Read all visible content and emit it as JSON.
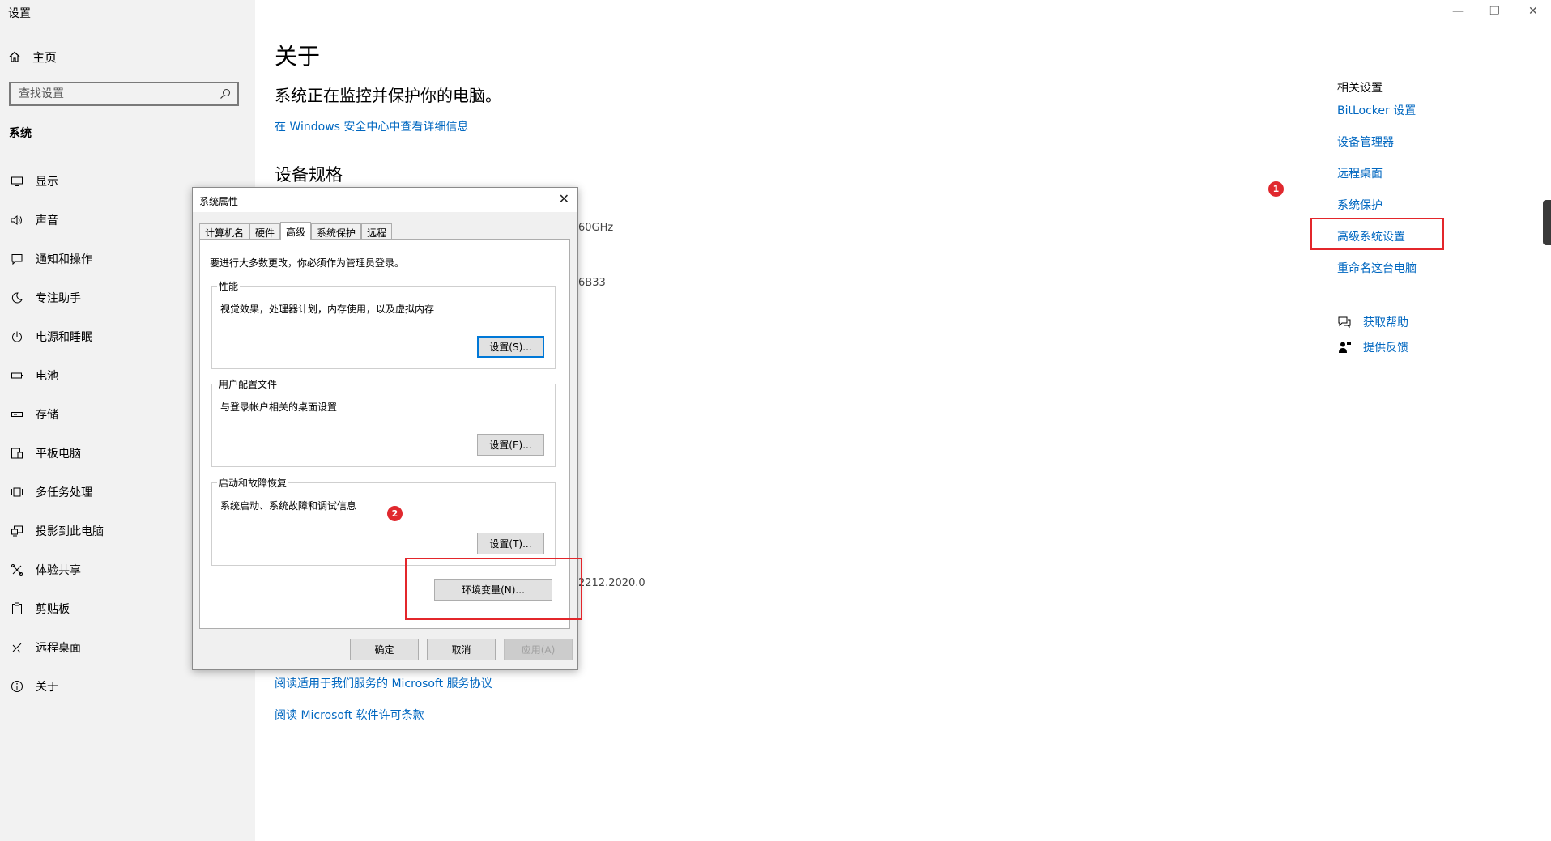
{
  "window": {
    "title": "设置",
    "minimize": "—",
    "restore": "❐",
    "close": "✕"
  },
  "sidebar": {
    "home": "主页",
    "search_placeholder": "查找设置",
    "section": "系统",
    "items": [
      {
        "label": "显示",
        "icon": "monitor-icon"
      },
      {
        "label": "声音",
        "icon": "speaker-icon"
      },
      {
        "label": "通知和操作",
        "icon": "notification-icon"
      },
      {
        "label": "专注助手",
        "icon": "moon-icon"
      },
      {
        "label": "电源和睡眠",
        "icon": "power-icon"
      },
      {
        "label": "电池",
        "icon": "battery-icon"
      },
      {
        "label": "存储",
        "icon": "storage-icon"
      },
      {
        "label": "平板电脑",
        "icon": "tablet-icon"
      },
      {
        "label": "多任务处理",
        "icon": "multitask-icon"
      },
      {
        "label": "投影到此电脑",
        "icon": "project-icon"
      },
      {
        "label": "体验共享",
        "icon": "share-icon"
      },
      {
        "label": "剪贴板",
        "icon": "clipboard-icon"
      },
      {
        "label": "远程桌面",
        "icon": "remote-icon"
      },
      {
        "label": "关于",
        "icon": "info-icon"
      }
    ]
  },
  "main": {
    "title": "关于",
    "status": "系统正在监控并保护你的电脑。",
    "security_link": "在 Windows 安全中心中查看详细信息",
    "specs_heading": "设备规格",
    "peek1": "60GHz",
    "peek2": "6B33",
    "peek3": "2212.2020.0",
    "agreement_link": "阅读适用于我们服务的 Microsoft 服务协议",
    "license_link": "阅读 Microsoft 软件许可条款"
  },
  "related": {
    "heading": "相关设置",
    "links": [
      "BitLocker 设置",
      "设备管理器",
      "远程桌面",
      "系统保护",
      "高级系统设置",
      "重命名这台电脑"
    ],
    "help": "获取帮助",
    "feedback": "提供反馈"
  },
  "markers": {
    "one": "1",
    "two": "2"
  },
  "dialog": {
    "title": "系统属性",
    "tabs": [
      "计算机名",
      "硬件",
      "高级",
      "系统保护",
      "远程"
    ],
    "active_tab": "高级",
    "admin_note": "要进行大多数更改，你必须作为管理员登录。",
    "performance": {
      "label": "性能",
      "desc": "视觉效果，处理器计划，内存使用，以及虚拟内存",
      "button": "设置(S)..."
    },
    "profiles": {
      "label": "用户配置文件",
      "desc": "与登录帐户相关的桌面设置",
      "button": "设置(E)..."
    },
    "startup": {
      "label": "启动和故障恢复",
      "desc": "系统启动、系统故障和调试信息",
      "button": "设置(T)..."
    },
    "env_button": "环境变量(N)...",
    "ok": "确定",
    "cancel": "取消",
    "apply": "应用(A)"
  },
  "colors": {
    "accent_link": "#0067c0",
    "highlight_red": "#e3262b",
    "sidebar_bg": "#f2f2f2"
  }
}
